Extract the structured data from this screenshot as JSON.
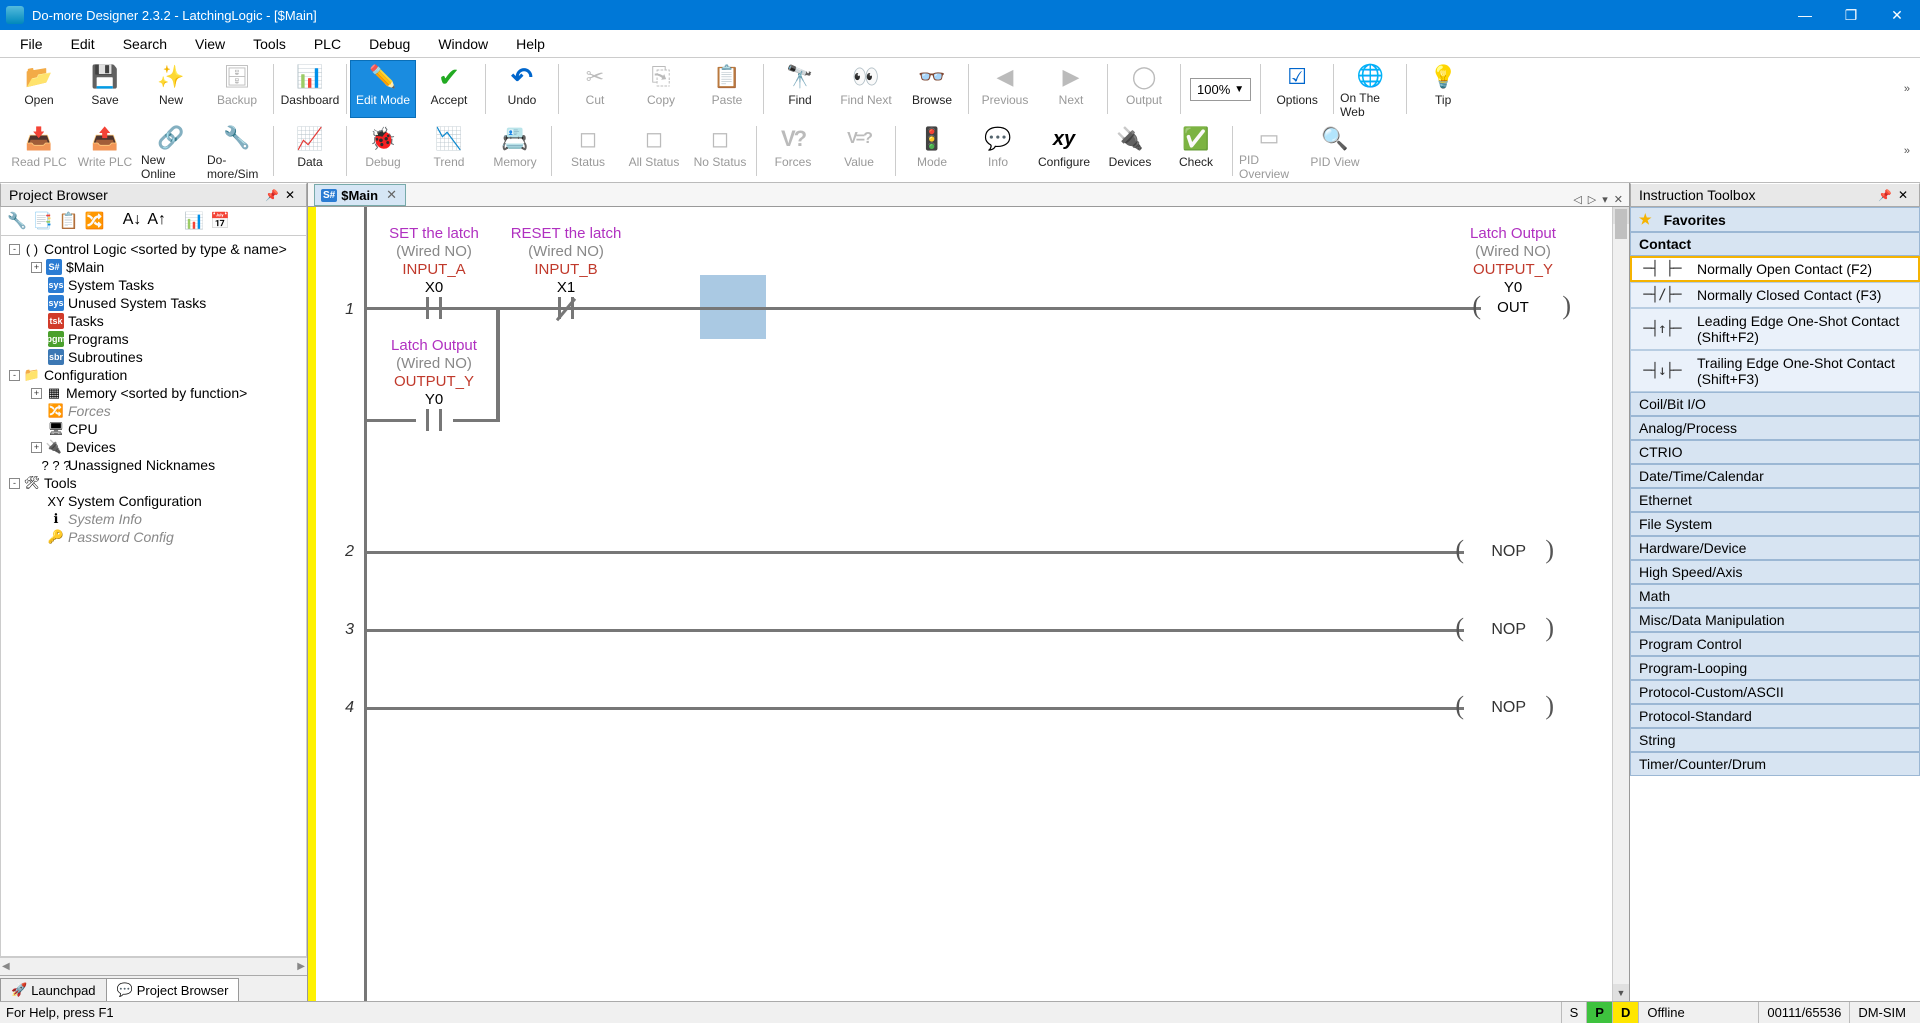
{
  "window": {
    "title": "Do-more Designer 2.3.2 - LatchingLogic - [$Main]",
    "min": "—",
    "max": "❐",
    "close": "✕"
  },
  "menu": [
    "File",
    "Edit",
    "Search",
    "View",
    "Tools",
    "PLC",
    "Debug",
    "Window",
    "Help"
  ],
  "toolbar_row1": [
    {
      "id": "open",
      "label": "Open",
      "icon": "ic-open"
    },
    {
      "id": "save",
      "label": "Save",
      "icon": "ic-save"
    },
    {
      "id": "new",
      "label": "New",
      "icon": "ic-new"
    },
    {
      "id": "backup",
      "label": "Backup",
      "icon": "ic-backup",
      "disabled": true
    },
    "|",
    {
      "id": "dashboard",
      "label": "Dashboard",
      "icon": "ic-dash"
    },
    "|",
    {
      "id": "editmode",
      "label": "Edit Mode",
      "icon": "ic-edit",
      "active": true
    },
    {
      "id": "accept",
      "label": "Accept",
      "icon": "ic-accept"
    },
    "|",
    {
      "id": "undo",
      "label": "Undo",
      "icon": "ic-undo"
    },
    "|",
    {
      "id": "cut",
      "label": "Cut",
      "icon": "ic-cut",
      "disabled": true
    },
    {
      "id": "copy",
      "label": "Copy",
      "icon": "ic-copy",
      "disabled": true
    },
    {
      "id": "paste",
      "label": "Paste",
      "icon": "ic-paste",
      "disabled": true
    },
    "|",
    {
      "id": "find",
      "label": "Find",
      "icon": "ic-find"
    },
    {
      "id": "findnext",
      "label": "Find Next",
      "icon": "ic-findnext",
      "disabled": true
    },
    {
      "id": "browse",
      "label": "Browse",
      "icon": "ic-browse"
    },
    "|",
    {
      "id": "previous",
      "label": "Previous",
      "icon": "ic-prev",
      "disabled": true
    },
    {
      "id": "next",
      "label": "Next",
      "icon": "ic-next",
      "disabled": true
    },
    "|",
    {
      "id": "output",
      "label": "Output",
      "icon": "ic-output",
      "disabled": true
    },
    "|",
    {
      "id": "zoom",
      "label": "100%",
      "zoom": true
    },
    "|",
    {
      "id": "options",
      "label": "Options",
      "icon": "ic-options"
    },
    "|",
    {
      "id": "ontheweb",
      "label": "On The Web",
      "icon": "ic-web"
    },
    "|",
    {
      "id": "tip",
      "label": "Tip",
      "icon": "ic-tip"
    }
  ],
  "toolbar_row2": [
    {
      "id": "readplc",
      "label": "Read PLC",
      "icon": "ic-readplc",
      "disabled": true
    },
    {
      "id": "writeplc",
      "label": "Write PLC",
      "icon": "ic-writeplc",
      "disabled": true
    },
    {
      "id": "newonline",
      "label": "New Online",
      "icon": "ic-newonline"
    },
    {
      "id": "domoresim",
      "label": "Do-more/Sim",
      "icon": "ic-sim"
    },
    "|",
    {
      "id": "data",
      "label": "Data",
      "icon": "ic-data"
    },
    "|",
    {
      "id": "debug",
      "label": "Debug",
      "icon": "ic-debug",
      "disabled": true
    },
    {
      "id": "trend",
      "label": "Trend",
      "icon": "ic-trend",
      "disabled": true
    },
    {
      "id": "memory",
      "label": "Memory",
      "icon": "ic-memory",
      "disabled": true
    },
    "|",
    {
      "id": "status",
      "label": "Status",
      "icon": "ic-status",
      "disabled": true
    },
    {
      "id": "allstatus",
      "label": "All Status",
      "icon": "ic-allstatus",
      "disabled": true
    },
    {
      "id": "nostatus",
      "label": "No Status",
      "icon": "ic-nostatus",
      "disabled": true
    },
    "|",
    {
      "id": "forces",
      "label": "Forces",
      "icon": "ic-forces",
      "disabled": true
    },
    {
      "id": "value",
      "label": "Value",
      "icon": "ic-value",
      "disabled": true
    },
    "|",
    {
      "id": "mode",
      "label": "Mode",
      "icon": "ic-mode",
      "disabled": true
    },
    {
      "id": "info",
      "label": "Info",
      "icon": "ic-info",
      "disabled": true
    },
    {
      "id": "configure",
      "label": "Configure",
      "icon": "ic-configure"
    },
    {
      "id": "devices",
      "label": "Devices",
      "icon": "ic-devices"
    },
    {
      "id": "check",
      "label": "Check",
      "icon": "ic-check"
    },
    "|",
    {
      "id": "pidoverview",
      "label": "PID Overview",
      "icon": "ic-pidov",
      "disabled": true
    },
    {
      "id": "pidview",
      "label": "PID View",
      "icon": "ic-pidview",
      "disabled": true
    }
  ],
  "project_browser": {
    "title": "Project Browser",
    "tree": [
      {
        "depth": 0,
        "exp": "-",
        "icon": "( )",
        "label": "Control Logic <sorted by type & name>"
      },
      {
        "depth": 1,
        "exp": "+",
        "icon": "S#",
        "iconbg": "#2b7cd3",
        "label": "$Main"
      },
      {
        "depth": 1,
        "exp": " ",
        "icon": "sys",
        "iconbg": "#2b7cd3",
        "label": "System Tasks"
      },
      {
        "depth": 1,
        "exp": " ",
        "icon": "sys",
        "iconbg": "#2b7cd3",
        "label": "Unused System Tasks"
      },
      {
        "depth": 1,
        "exp": " ",
        "icon": "tsk",
        "iconbg": "#d13b2a",
        "label": "Tasks"
      },
      {
        "depth": 1,
        "exp": " ",
        "icon": "pgm",
        "iconbg": "#4aa02c",
        "label": "Programs"
      },
      {
        "depth": 1,
        "exp": " ",
        "icon": "sbr",
        "iconbg": "#3c78b4",
        "label": "Subroutines"
      },
      {
        "depth": 0,
        "exp": "-",
        "icon": "📁",
        "label": "Configuration"
      },
      {
        "depth": 1,
        "exp": "+",
        "icon": "▦",
        "label": "Memory <sorted by function>"
      },
      {
        "depth": 1,
        "exp": " ",
        "icon": "🔀",
        "label": "Forces",
        "muted": true
      },
      {
        "depth": 1,
        "exp": " ",
        "icon": "🖥",
        "label": "CPU"
      },
      {
        "depth": 1,
        "exp": "+",
        "icon": "🔌",
        "label": "Devices"
      },
      {
        "depth": 1,
        "exp": " ",
        "icon": "? ? ?",
        "label": "Unassigned Nicknames"
      },
      {
        "depth": 0,
        "exp": "-",
        "icon": "🛠",
        "label": "Tools"
      },
      {
        "depth": 1,
        "exp": " ",
        "icon": "XY",
        "label": "System Configuration"
      },
      {
        "depth": 1,
        "exp": " ",
        "icon": "ℹ",
        "label": "System Info",
        "muted": true
      },
      {
        "depth": 1,
        "exp": " ",
        "icon": "🔑",
        "label": "Password Config",
        "muted": true
      }
    ],
    "tabs": [
      {
        "label": "Launchpad",
        "icon": "🚀"
      },
      {
        "label": "Project Browser",
        "icon": "💬",
        "active": true
      }
    ]
  },
  "editor": {
    "tab_icon": "S#",
    "tab_label": "$Main",
    "rung1": {
      "num": "1",
      "c1": {
        "desc": "SET the latch",
        "wired": "(Wired NO)",
        "nick": "INPUT_A",
        "addr": "X0"
      },
      "c2": {
        "desc": "RESET the latch",
        "wired": "(Wired NO)",
        "nick": "INPUT_B",
        "addr": "X1"
      },
      "out": {
        "desc": "Latch Output",
        "wired": "(Wired NO)",
        "nick": "OUTPUT_Y",
        "addr": "Y0",
        "type": "OUT"
      },
      "branch": {
        "desc": "Latch Output",
        "wired": "(Wired NO)",
        "nick": "OUTPUT_Y",
        "addr": "Y0"
      }
    },
    "nop_rungs": [
      {
        "num": "2",
        "op": "NOP"
      },
      {
        "num": "3",
        "op": "NOP"
      },
      {
        "num": "4",
        "op": "NOP"
      }
    ]
  },
  "toolbox": {
    "title": "Instruction Toolbox",
    "favorites": "Favorites",
    "contact_header": "Contact",
    "contact_items": [
      {
        "sym": "─┤ ├─",
        "label": "Normally Open Contact (F2)",
        "selected": true
      },
      {
        "sym": "─┤/├─",
        "label": "Normally Closed Contact (F3)"
      },
      {
        "sym": "─┤↑├─",
        "label": "Leading Edge One-Shot Contact (Shift+F2)"
      },
      {
        "sym": "─┤↓├─",
        "label": "Trailing Edge One-Shot Contact (Shift+F3)"
      }
    ],
    "groups": [
      "Coil/Bit I/O",
      "Analog/Process",
      "CTRIO",
      "Date/Time/Calendar",
      "Ethernet",
      "File System",
      "Hardware/Device",
      "High Speed/Axis",
      "Math",
      "Misc/Data Manipulation",
      "Program Control",
      "Program-Looping",
      "Protocol-Custom/ASCII",
      "Protocol-Standard",
      "String",
      "Timer/Counter/Drum"
    ]
  },
  "statusbar": {
    "help": "For Help, press F1",
    "s": "S",
    "p": "P",
    "d": "D",
    "offline": "Offline",
    "pos": "00111/65536",
    "device": "DM-SIM"
  }
}
